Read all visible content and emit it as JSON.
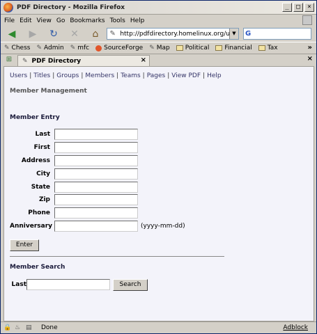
{
  "window": {
    "title": "PDF Directory - Mozilla Firefox"
  },
  "menu": [
    "File",
    "Edit",
    "View",
    "Go",
    "Bookmarks",
    "Tools",
    "Help"
  ],
  "address": {
    "url": "http://pdfdirectory.homelinux.org/ui.php",
    "search_logo": "G"
  },
  "bookmarks": [
    {
      "label": "Chess",
      "icon": "page-icon"
    },
    {
      "label": "Admin",
      "icon": "page-icon"
    },
    {
      "label": "mfc",
      "icon": "page-icon"
    },
    {
      "label": "SourceForge",
      "icon": "sourceforge-icon"
    },
    {
      "label": "Map",
      "icon": "page-icon"
    },
    {
      "label": "Political",
      "icon": "folder-icon"
    },
    {
      "label": "Financial",
      "icon": "folder-icon"
    },
    {
      "label": "Tax",
      "icon": "folder-icon"
    }
  ],
  "tab": {
    "label": "PDF Directory"
  },
  "page": {
    "nav_links": [
      "Users",
      "Titles",
      "Groups",
      "Members",
      "Teams",
      "Pages",
      "View PDF",
      "Help"
    ],
    "heading": "Member Management",
    "entry": {
      "title": "Member Entry",
      "fields": [
        {
          "label": "Last",
          "value": ""
        },
        {
          "label": "First",
          "value": ""
        },
        {
          "label": "Address",
          "value": ""
        },
        {
          "label": "City",
          "value": ""
        },
        {
          "label": "State",
          "value": ""
        },
        {
          "label": "Zip",
          "value": ""
        },
        {
          "label": "Phone",
          "value": ""
        },
        {
          "label": "Anniversary",
          "value": "",
          "hint": "(yyyy-mm-dd)"
        }
      ],
      "submit_label": "Enter"
    },
    "search": {
      "title": "Member Search",
      "field_label": "Last",
      "field_value": "",
      "button_label": "Search"
    }
  },
  "status": {
    "text": "Done",
    "adblock": "Adblock"
  }
}
